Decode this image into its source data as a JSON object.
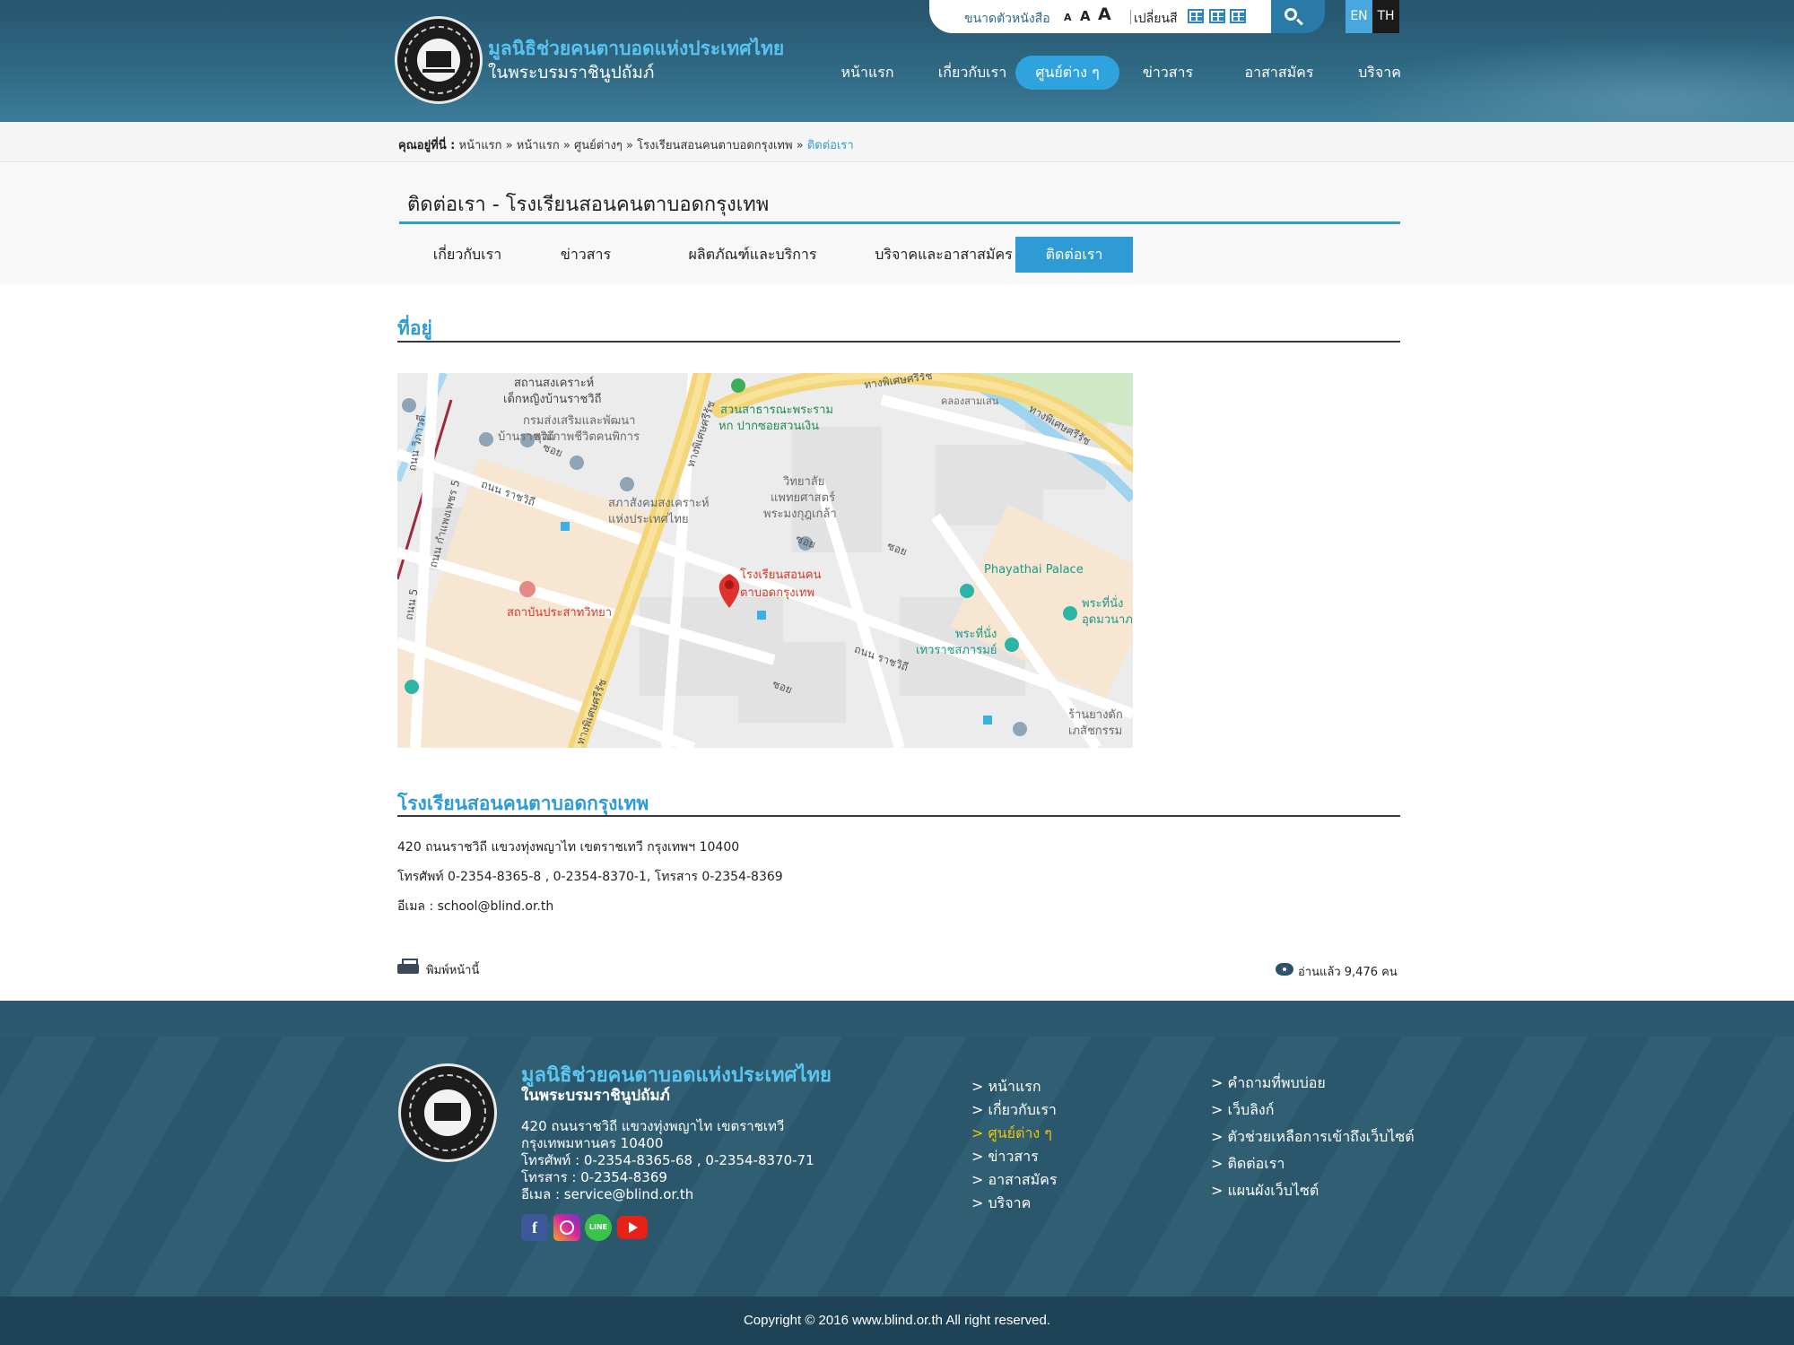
{
  "header": {
    "org_name_line1": "มูลนิธิช่วยคนตาบอดแห่งประเทศไทย",
    "org_name_line2": "ในพระบรมราชินูปถัมภ์",
    "font_size_label": "ขนาดตัวหนังสือ",
    "font_sizes": [
      "A",
      "A",
      "A"
    ],
    "color_label": "เปลี่ยนสี",
    "lang_en": "EN",
    "lang_th": "TH",
    "nav": [
      "หน้าแรก",
      "เกี่ยวกับเรา",
      "ศูนย์ต่าง ๆ",
      "ข่าวสาร",
      "อาสาสมัคร",
      "บริจาค"
    ],
    "nav_active_index": 2
  },
  "breadcrumb": {
    "label": "คุณอยู่ที่นี่ :",
    "items": [
      "หน้าแรก",
      "หน้าแรก",
      "ศูนย์ต่างๆ",
      "โรงเรียนสอนคนตาบอดกรุงเทพ"
    ],
    "separator": "»",
    "current": "ติดต่อเรา"
  },
  "page": {
    "title": "ติดต่อเรา - โรงเรียนสอนคนตาบอดกรุงเทพ",
    "subnav": [
      "เกี่ยวกับเรา",
      "ข่าวสาร",
      "ผลิตภัณฑ์และบริการ",
      "บริจาคและอาสาสมัคร",
      "ติดต่อเรา"
    ],
    "subnav_active_index": 4
  },
  "address_section": {
    "heading": "ที่อยู่"
  },
  "map": {
    "labels": {
      "shelter": "สถานสงเคราะห์",
      "shelter2": "เด็กหญิงบ้านราชวิถี",
      "dept": "กรมส่งเสริมและพัฒนา",
      "dept2": "คุณภาพชีวิตคนพิการ",
      "banrajwithi": "บ้านราชวิถี",
      "park": "สวนสาธารณะพระราม",
      "park2": "หก ปากซอยสวนเงิน",
      "college": "วิทยาลัย",
      "college2": "แพทยศาสตร์",
      "college3": "พระมงกุฎเกล้า",
      "council": "สภาสังคมสงเคราะห์",
      "council2": "แห่งประเทศไทย",
      "school": "โรงเรียนสอนคน",
      "school2": "ตาบอดกรุงเทพ",
      "hospital": "สถาบันประสาทวิทยา",
      "palace": "Phayathai Palace",
      "throne": "พระที่นั่ง",
      "throne2": "เทวราชสภารมย์",
      "throne_r": "พระที่นั่ง",
      "throne_r2": "อุดมวนาภ",
      "shop": "ร้านยางดัก",
      "shop2": "เภสัชกรรม",
      "canal": "คลองสามเสน",
      "road_rajwithi": "ถนน ราชวิถี",
      "road_rajwithi2": "ถนน ราชวิถี",
      "road_kampaengphet": "ถนน กำแพงเพชร 5",
      "road_sriayutthaya": "ทางพิเศษศรีรัช",
      "road_expressway_top": "ทางพิเศษศรีรัช",
      "road_expressway_r": "ทางพิเศษศรีรัช",
      "road_expressway_bot": "ทางพิเศษศรีรัช",
      "soi": "ซอย",
      "road_left": "ถนน วิภาวดี",
      "road_left2": "ถนน 5"
    }
  },
  "contact": {
    "heading": "โรงเรียนสอนคนตาบอดกรุงเทพ",
    "address": "420 ถนนราชวิถี แขวงทุ่งพญาไท เขตราชเทวี กรุงเทพฯ 10400",
    "phone": "โทรศัพท์ 0-2354-8365-8 , 0-2354-8370-1, โทรสาร 0-2354-8369",
    "email": "อีเมล : school@blind.or.th"
  },
  "actions": {
    "print_label": "พิมพ์หน้านี้",
    "views_label": "อ่านแล้ว 9,476 คน"
  },
  "footer": {
    "org_name_line1": "มูลนิธิช่วยคนตาบอดแห่งประเทศไทย",
    "org_name_line2": "ในพระบรมราชินูปถัมภ์",
    "address_line1": "420 ถนนราชวิถี แขวงทุ่งพญาไท เขตราชเทวี",
    "address_line2": "กรุงเทพมหานคร 10400",
    "phone": "โทรศัพท์ : 0-2354-8365-68 , 0-2354-8370-71",
    "fax": "โทรสาร : 0-2354-8369",
    "email": "อีเมล : service@blind.or.th",
    "social": [
      "f",
      "ig",
      "LINE",
      "yt"
    ],
    "links_col1": [
      "> หน้าแรก",
      "> เกี่ยวกับเรา",
      "> ศูนย์ต่าง ๆ",
      "> ข่าวสาร",
      "> อาสาสมัคร",
      "> บริจาค"
    ],
    "links_col1_active_index": 2,
    "links_col2": [
      "> คำถามที่พบบ่อย",
      "> เว็บลิงก์",
      "> ตัวช่วยเหลือการเข้าถึงเว็บไซต์",
      "> ติดต่อเรา",
      "> แผนผังเว็บไซต์"
    ],
    "copyright": "Copyright © 2016 www.blind.or.th All right reserved."
  },
  "colors": {
    "accent": "#2e9bd4",
    "header_bg": "#2f6882",
    "footer_bg": "#2b5a70",
    "footer_highlight": "#f5c400"
  }
}
